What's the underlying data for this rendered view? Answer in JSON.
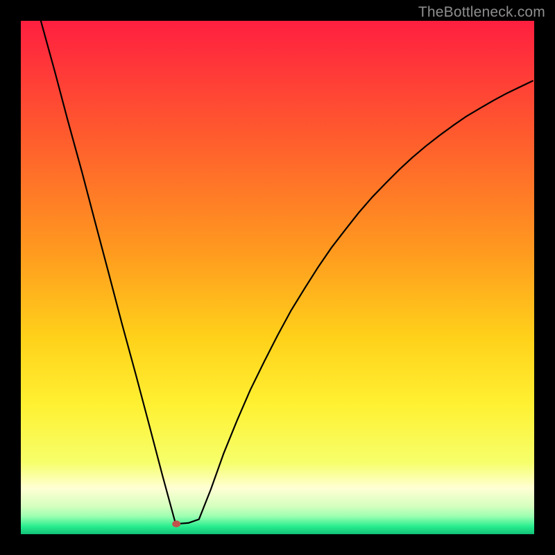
{
  "watermark": "TheBottleneck.com",
  "chart_data": {
    "type": "line",
    "title": "",
    "xlabel": "",
    "ylabel": "",
    "xlim": [
      0,
      100
    ],
    "ylim": [
      0,
      100
    ],
    "grid": false,
    "legend": false,
    "series": [
      {
        "name": "curve",
        "x": [
          3.9,
          6.6,
          9.2,
          11.9,
          14.5,
          17.1,
          19.7,
          22.4,
          25.0,
          27.6,
          30.0,
          30.3,
          32.7,
          34.7,
          37.0,
          39.5,
          42.1,
          44.7,
          47.4,
          50.0,
          52.6,
          55.3,
          57.9,
          60.5,
          63.2,
          65.8,
          68.4,
          71.1,
          73.7,
          76.3,
          78.9,
          81.6,
          84.2,
          86.8,
          89.5,
          92.1,
          94.7,
          97.4,
          99.7
        ],
        "y": [
          100.0,
          90.2,
          80.4,
          70.6,
          60.7,
          50.9,
          41.0,
          31.1,
          21.3,
          11.4,
          2.6,
          2.0,
          2.2,
          2.9,
          8.7,
          15.7,
          22.1,
          28.1,
          33.6,
          38.7,
          43.5,
          47.9,
          52.0,
          55.8,
          59.3,
          62.6,
          65.6,
          68.4,
          71.0,
          73.4,
          75.6,
          77.7,
          79.6,
          81.4,
          83.0,
          84.5,
          85.9,
          87.2,
          88.3
        ]
      }
    ],
    "marker": {
      "x": 30.3,
      "y": 2.0,
      "color": "#c0524c",
      "r": 6
    },
    "background_gradient": {
      "stops": [
        {
          "offset": 0.0,
          "color": "#ff1f40"
        },
        {
          "offset": 0.22,
          "color": "#ff5a2e"
        },
        {
          "offset": 0.45,
          "color": "#ff9a1f"
        },
        {
          "offset": 0.62,
          "color": "#ffd21a"
        },
        {
          "offset": 0.75,
          "color": "#fff133"
        },
        {
          "offset": 0.86,
          "color": "#f6ff6a"
        },
        {
          "offset": 0.91,
          "color": "#ffffd4"
        },
        {
          "offset": 0.945,
          "color": "#d6ffbf"
        },
        {
          "offset": 0.965,
          "color": "#9dffb2"
        },
        {
          "offset": 0.985,
          "color": "#28ed8e"
        },
        {
          "offset": 1.0,
          "color": "#10c176"
        }
      ]
    }
  }
}
